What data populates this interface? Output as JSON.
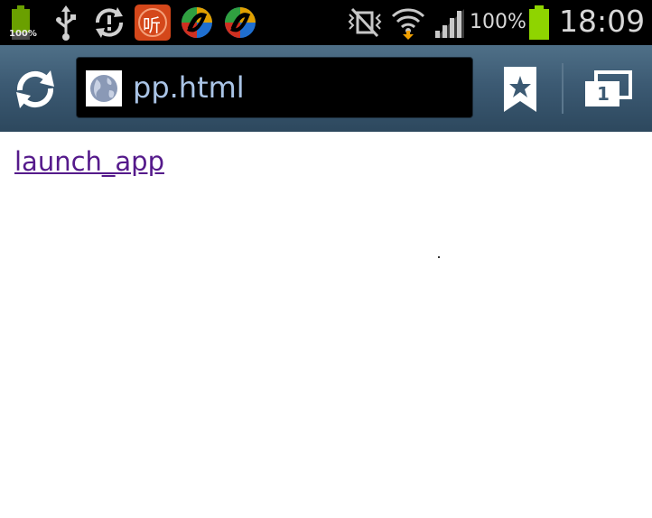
{
  "status_bar": {
    "battery_small_label": "100%",
    "battery_percent": "100%",
    "time": "18:09",
    "app_icon_char": "听",
    "icons": [
      "battery-icon",
      "usb-icon",
      "sync-icon",
      "listen-app-icon",
      "app-icon",
      "app-icon",
      "vibrate-silent-icon",
      "wifi-icon",
      "signal-icon",
      "battery-icon"
    ],
    "battery_color": "#8fd400"
  },
  "toolbar": {
    "url": "pp.html",
    "tabs_count": "1",
    "icons": [
      "refresh-icon",
      "globe-icon",
      "bookmark-icon",
      "tabs-icon"
    ]
  },
  "page": {
    "link_text": "launch_app",
    "link_color": "#551a8b"
  }
}
